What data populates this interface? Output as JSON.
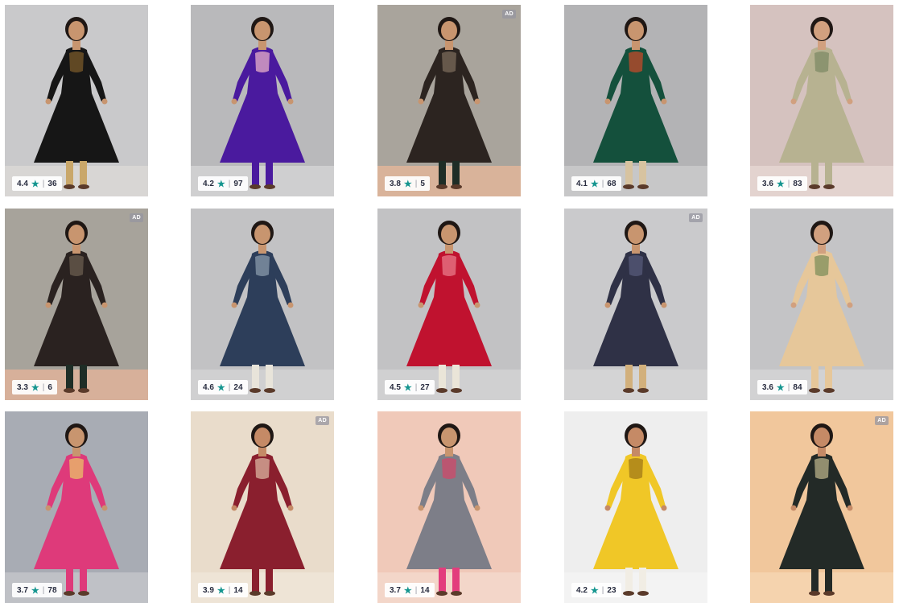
{
  "ad_label": "AD",
  "products": [
    {
      "rating": "4.4",
      "count": "36",
      "ad": false,
      "bg": "#c9c9cb",
      "floor": "#d8d6d4",
      "dress": "#161616",
      "accent": "#7a5a2a",
      "skin": "#c8956f",
      "pants": "#c9a76a"
    },
    {
      "rating": "4.2",
      "count": "97",
      "ad": false,
      "bg": "#b9b9bb",
      "floor": "#cfcfd0",
      "dress": "#4a1a9e",
      "accent": "#e8b0c8",
      "skin": "#c8956f",
      "pants": "#4a1a9e"
    },
    {
      "rating": "3.8",
      "count": "5",
      "ad": true,
      "bg": "#a9a49c",
      "floor": "#d9b39a",
      "dress": "#2c2420",
      "accent": "#7a6a5a",
      "skin": "#c8956f",
      "pants": "#1e2d26"
    },
    {
      "rating": "4.1",
      "count": "68",
      "ad": false,
      "bg": "#b3b3b5",
      "floor": "#c7c7c8",
      "dress": "#14503c",
      "accent": "#c24a2a",
      "skin": "#c8956f",
      "pants": "#d7c3a0"
    },
    {
      "rating": "3.6",
      "count": "83",
      "ad": false,
      "bg": "#d5c2bf",
      "floor": "#e3d3cf",
      "dress": "#b7b291",
      "accent": "#7e8a66",
      "skin": "#d1a07f",
      "pants": "#b7b291"
    },
    {
      "rating": "3.3",
      "count": "6",
      "ad": true,
      "bg": "#a7a39b",
      "floor": "#d7b09a",
      "dress": "#2a2220",
      "accent": "#6b5d4f",
      "skin": "#c8956f",
      "pants": "#1e2d26"
    },
    {
      "rating": "4.6",
      "count": "24",
      "ad": false,
      "bg": "#c2c2c4",
      "floor": "#d0d0d1",
      "dress": "#2d3e5a",
      "accent": "#8899ab",
      "skin": "#c8956f",
      "pants": "#e8e4da"
    },
    {
      "rating": "4.5",
      "count": "27",
      "ad": false,
      "bg": "#c2c2c4",
      "floor": "#d0d0d1",
      "dress": "#c0122f",
      "accent": "#e87a8a",
      "skin": "#c8956f",
      "pants": "#eae5d8"
    },
    {
      "rating": "",
      "count": "",
      "ad": true,
      "bg": "#cacacc",
      "floor": "#d4d4d5",
      "dress": "#2f3146",
      "accent": "#57597a",
      "skin": "#c8956f",
      "pants": "#d2b07c"
    },
    {
      "rating": "3.6",
      "count": "84",
      "ad": false,
      "bg": "#c4c4c6",
      "floor": "#d2d2d3",
      "dress": "#e6c79a",
      "accent": "#7f8f5a",
      "skin": "#d1a07f",
      "pants": "#e6c79a"
    },
    {
      "rating": "3.7",
      "count": "78",
      "ad": false,
      "bg": "#a8acb4",
      "floor": "#bfc1c6",
      "dress": "#de3a7a",
      "accent": "#e9c26a",
      "skin": "#c8956f",
      "pants": "#de3a7a"
    },
    {
      "rating": "3.9",
      "count": "14",
      "ad": true,
      "bg": "#e9dccb",
      "floor": "#eee4d6",
      "dress": "#8a1f2e",
      "accent": "#d9b4a0",
      "skin": "#c58a66",
      "pants": "#8a1f2e"
    },
    {
      "rating": "3.7",
      "count": "14",
      "ad": false,
      "bg": "#f0c9b9",
      "floor": "#f3d6c9",
      "dress": "#7d7e88",
      "accent": "#d04a6a",
      "skin": "#c8956f",
      "pants": "#e33d7d"
    },
    {
      "rating": "4.2",
      "count": "23",
      "ad": false,
      "bg": "#eeeeee",
      "floor": "#f3f3f3",
      "dress": "#f0c727",
      "accent": "#a27a18",
      "skin": "#c58a66",
      "pants": "#f1ede4"
    },
    {
      "rating": "",
      "count": "",
      "ad": true,
      "bg": "#f1c79c",
      "floor": "#f5d3ae",
      "dress": "#232a27",
      "accent": "#b8b088",
      "skin": "#c58a66",
      "pants": "#232a27"
    }
  ]
}
